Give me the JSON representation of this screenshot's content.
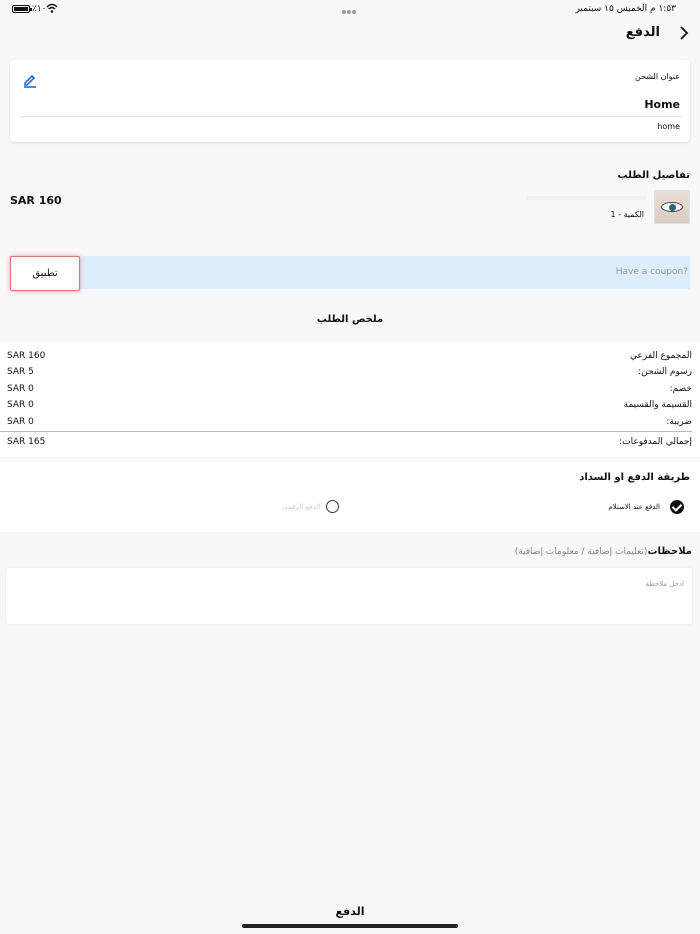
{
  "status_bar": {
    "battery": "٪١٠٠",
    "time_date": "١:٥٣ م   الخميس ١٥ سبتمبر"
  },
  "header": {
    "title": "الدفع"
  },
  "shipping": {
    "label": "عنوان الشحن",
    "name": "Home",
    "detail": "home"
  },
  "order_details": {
    "title": "تفاصيل الطلب",
    "quantity": "الكمية - 1",
    "price": "SAR 160"
  },
  "coupon": {
    "placeholder": "Have a coupon?",
    "apply_label": "تطبيق"
  },
  "summary": {
    "title": "ملخص الطلب",
    "rows": [
      {
        "label": "المجموع الفرعي",
        "value": "SAR 160"
      },
      {
        "label": "رسوم الشحن:",
        "value": "SAR 5"
      },
      {
        "label": "خصم:",
        "value": "SAR 0"
      },
      {
        "label": "القسيمة والقسيمة",
        "value": "SAR 0"
      },
      {
        "label": "ضريبة:",
        "value": "SAR 0"
      }
    ],
    "total_label": "إجمالي المدفوعات:",
    "total_value": "SAR 165"
  },
  "payment": {
    "title": "طريقة الدفع او السداد",
    "option_cod": "الدفع عند الاستلام",
    "option_online": "الدفع الرقمي"
  },
  "notes": {
    "title": "ملاحظات",
    "hint": "(تعليمات إضافية / معلومات إضافية)",
    "placeholder": "ادخل ملاحظة"
  },
  "footer": {
    "pay_label": "الدفع"
  }
}
